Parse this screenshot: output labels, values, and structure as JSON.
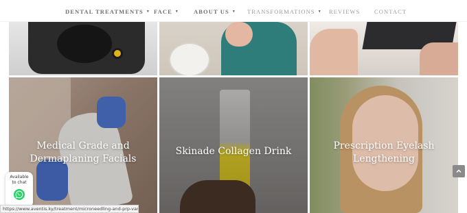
{
  "nav": {
    "items": [
      {
        "label": "DENTAL TREATMENTS",
        "caret": "▼"
      },
      {
        "label": "FACE",
        "caret": "▼"
      },
      {
        "label": "ABOUT US",
        "caret": "▼"
      },
      {
        "label": "TRANSFORMATIONS",
        "caret": "▼"
      },
      {
        "label": "REVIEWS"
      },
      {
        "label": "CONTACT"
      }
    ]
  },
  "tiles": {
    "medical": "Medical Grade and\nDermaplaning Facials",
    "skinade": "Skinade Collagen Drink",
    "eyelash": "Prescription Eyelash\nLengthening"
  },
  "chat": {
    "line1": "Available",
    "line2": "to chat"
  },
  "status_url": "https://www.aventis.ky/treatment/microneedling-and-prp-vampire-facial/",
  "colors": {
    "nav_text": "#6f6f6f",
    "whatsapp": "#25d366",
    "tile_text": "#ffffff"
  }
}
